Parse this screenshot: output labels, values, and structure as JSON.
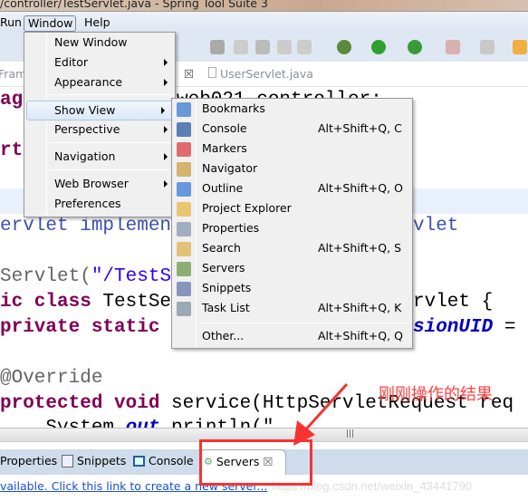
{
  "window_title": "/controller/TestServlet.java - Spring Tool Suite 3",
  "menubar": {
    "items": [
      "Run",
      "Window",
      "Help"
    ]
  },
  "editor_tabs": [
    "Fram",
    "UserServlet.java"
  ],
  "code_fragments": {
    "l1a": "ag",
    "l1b": "web021.controller;",
    "l2": "rt",
    "l3a": "ervlet implemen",
    "l3b": "vlet",
    "l4a": "Servlet(",
    "l4b": "\"/TestS",
    "l5a": "ic class ",
    "l5b": "TestSe",
    "l5c": "rvlet {",
    "l6a": "private static",
    "l6b": "sionUID",
    "l6c": " =",
    "l7": "@Override",
    "l8a": "protected void ",
    "l8b": "service(HttpServletRequest req",
    "l9a": "    System.",
    "l9b": "out",
    "l9c": ".println(\""
  },
  "window_menu": {
    "items": [
      {
        "label": "New Window",
        "submenu": false
      },
      {
        "label": "Editor",
        "submenu": true
      },
      {
        "label": "Appearance",
        "submenu": true
      },
      {
        "label": "Show View",
        "submenu": true,
        "highlighted": true
      },
      {
        "label": "Perspective",
        "submenu": true
      },
      {
        "label": "Navigation",
        "submenu": true
      },
      {
        "label": "Web Browser",
        "submenu": true
      },
      {
        "label": "Preferences",
        "submenu": false
      }
    ]
  },
  "show_view_menu": {
    "items": [
      {
        "label": "Bookmarks",
        "shortcut": "",
        "icon": "bookmarks-icon"
      },
      {
        "label": "Console",
        "shortcut": "Alt+Shift+Q, C",
        "icon": "console-icon"
      },
      {
        "label": "Markers",
        "shortcut": "",
        "icon": "markers-icon"
      },
      {
        "label": "Navigator",
        "shortcut": "",
        "icon": "navigator-icon"
      },
      {
        "label": "Outline",
        "shortcut": "Alt+Shift+Q, O",
        "icon": "outline-icon"
      },
      {
        "label": "Project Explorer",
        "shortcut": "",
        "icon": "project-explorer-icon"
      },
      {
        "label": "Properties",
        "shortcut": "",
        "icon": "properties-icon"
      },
      {
        "label": "Search",
        "shortcut": "Alt+Shift+Q, S",
        "icon": "search-icon"
      },
      {
        "label": "Servers",
        "shortcut": "",
        "icon": "servers-icon"
      },
      {
        "label": "Snippets",
        "shortcut": "",
        "icon": "snippets-icon"
      },
      {
        "label": "Task List",
        "shortcut": "Alt+Shift+Q, K",
        "icon": "task-list-icon"
      },
      {
        "label": "Other...",
        "shortcut": "Alt+Shift+Q, Q",
        "icon": ""
      }
    ]
  },
  "bottom_tabs": [
    {
      "label": "Properties"
    },
    {
      "label": "Snippets"
    },
    {
      "label": "Console"
    },
    {
      "label": "Servers",
      "active": true
    }
  ],
  "servers_link": "vailable. Click this link to create a new server...",
  "annotation": "刚刚操作的结果",
  "watermark": "https://blog.csdn.net/weixin_43441790",
  "colors": {
    "annotation": "#f53333",
    "keyword": "#7f0055",
    "string": "#2a00ff",
    "link": "#1a4fd6"
  }
}
